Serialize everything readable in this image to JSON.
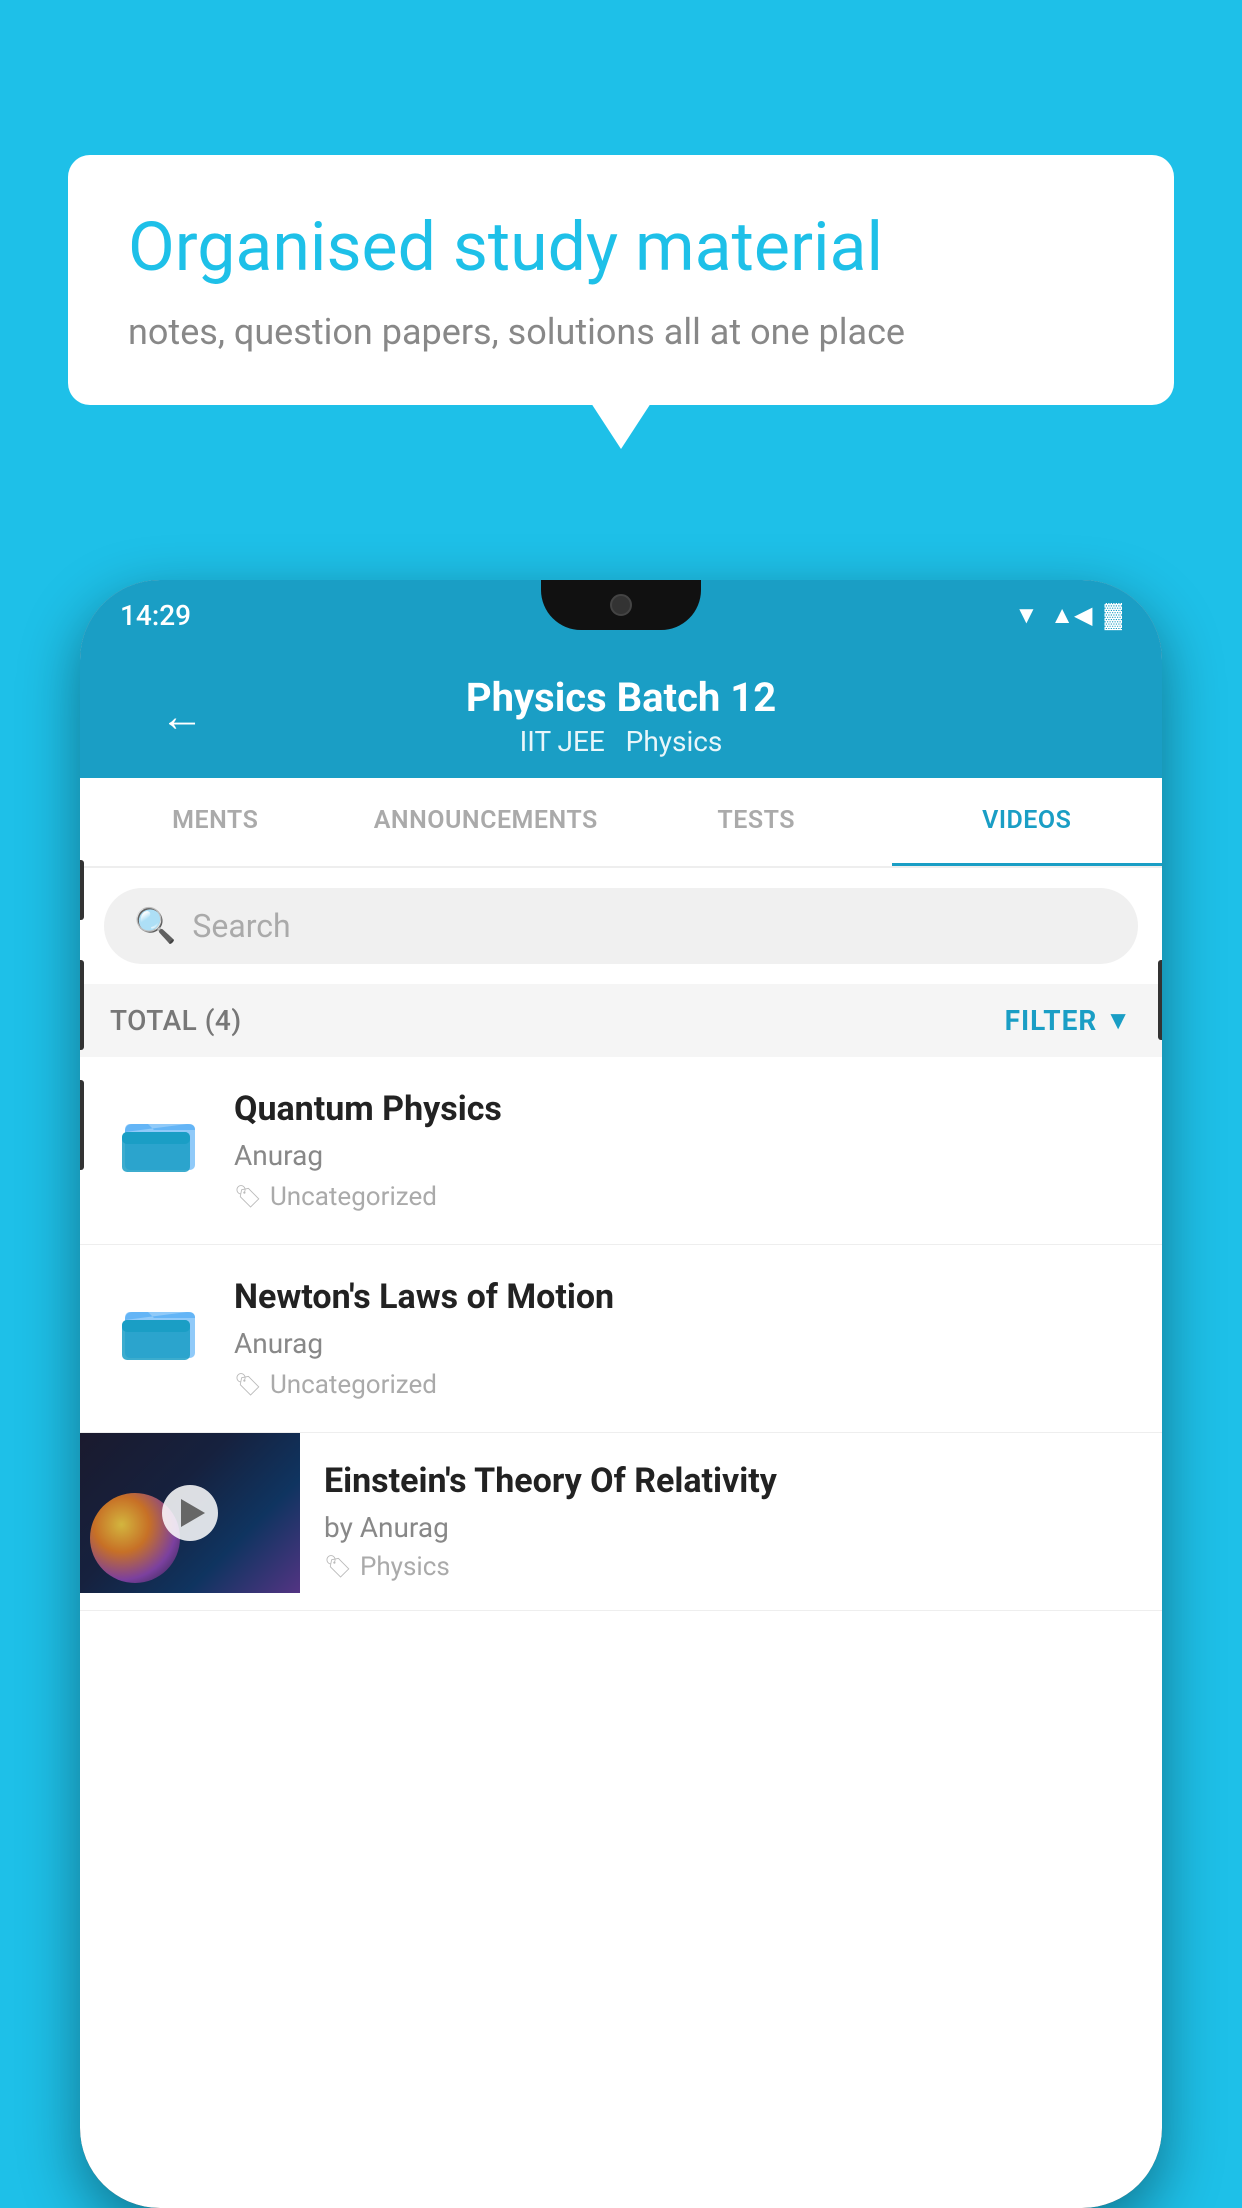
{
  "background": {
    "color": "#1ec0e8"
  },
  "speech_bubble": {
    "title": "Organised study material",
    "subtitle": "notes, question papers, solutions all at one place"
  },
  "phone": {
    "status_bar": {
      "time": "14:29"
    },
    "header": {
      "title": "Physics Batch 12",
      "subtitle_tags": [
        "IIT JEE",
        "Physics"
      ],
      "back_arrow": "←"
    },
    "tabs": [
      {
        "label": "MENTS",
        "active": false
      },
      {
        "label": "ANNOUNCEMENTS",
        "active": false
      },
      {
        "label": "TESTS",
        "active": false
      },
      {
        "label": "VIDEOS",
        "active": true
      }
    ],
    "search": {
      "placeholder": "Search"
    },
    "filter": {
      "total_label": "TOTAL (4)",
      "filter_label": "FILTER"
    },
    "videos": [
      {
        "id": 1,
        "title": "Quantum Physics",
        "author": "Anurag",
        "tag": "Uncategorized",
        "type": "folder"
      },
      {
        "id": 2,
        "title": "Newton's Laws of Motion",
        "author": "Anurag",
        "tag": "Uncategorized",
        "type": "folder"
      },
      {
        "id": 3,
        "title": "Einstein's Theory Of Relativity",
        "author": "by Anurag",
        "tag": "Physics",
        "type": "video"
      }
    ]
  }
}
